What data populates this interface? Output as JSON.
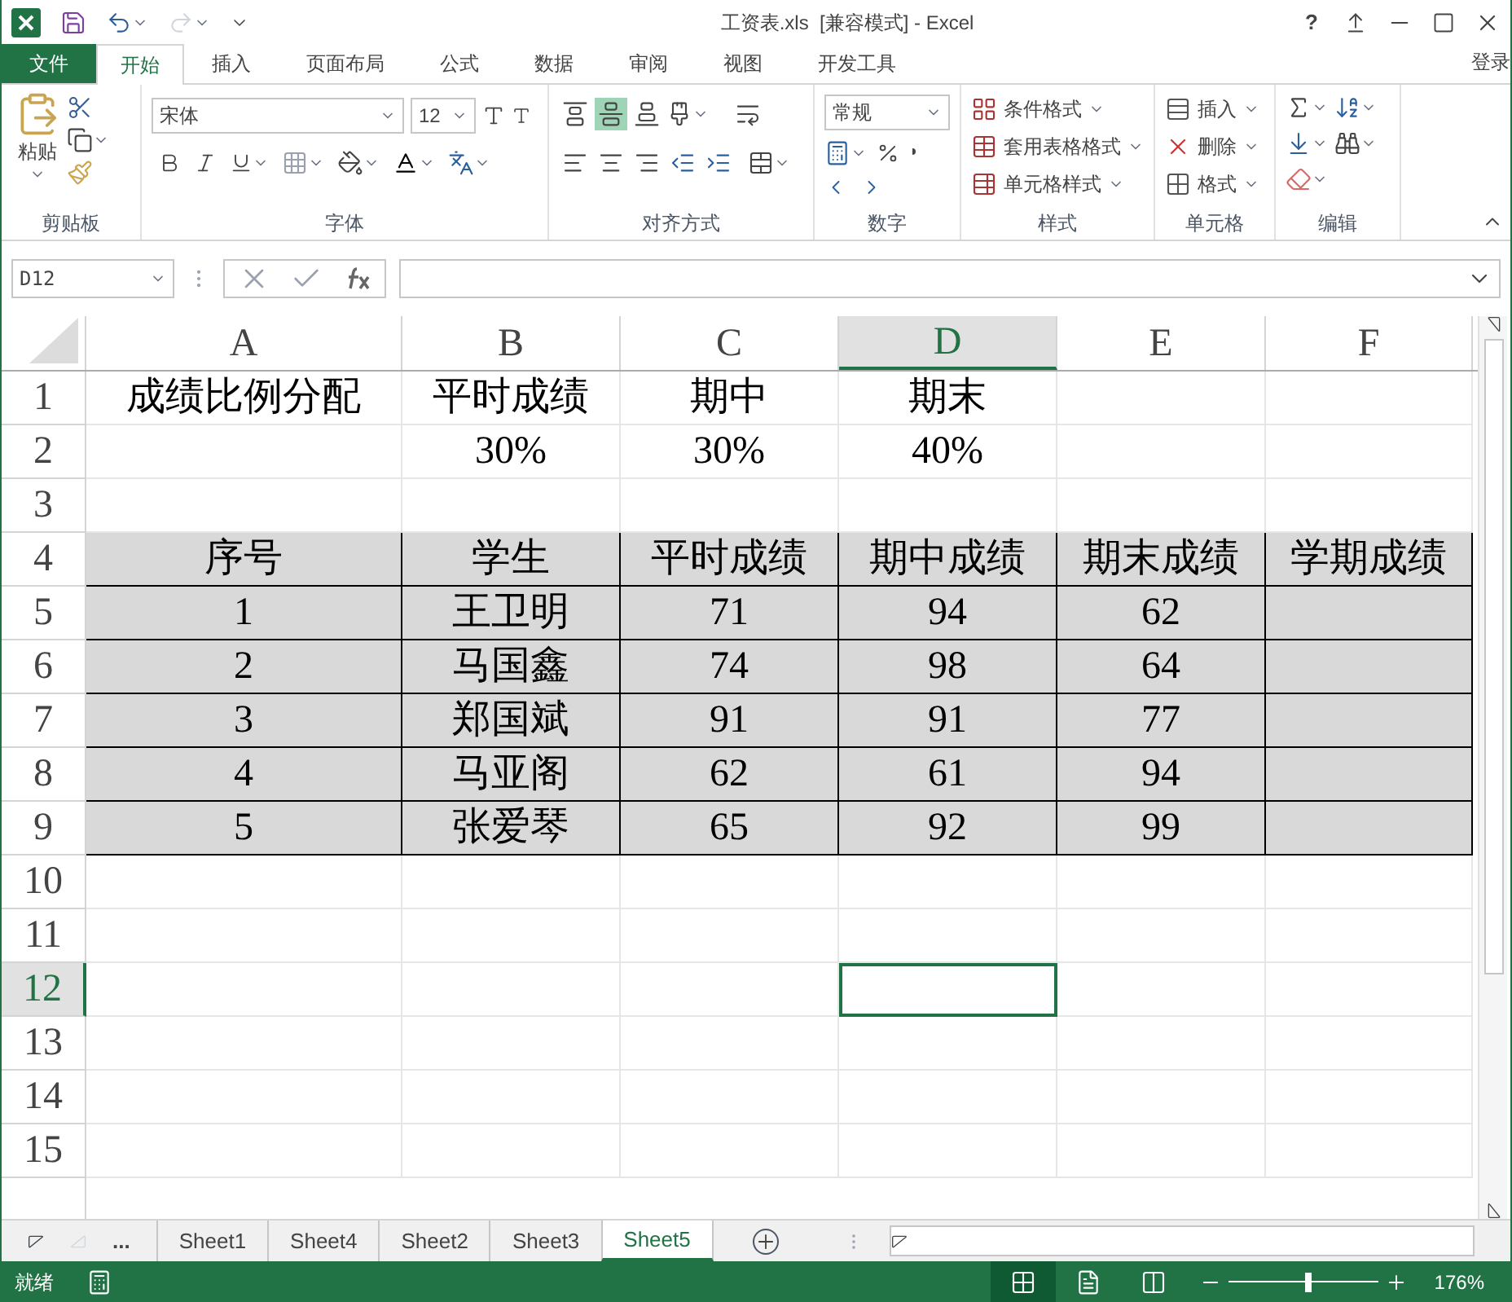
{
  "title_bar": {
    "title": "工资表.xls  [兼容模式] - Excel",
    "help": "?"
  },
  "ribbon_tabs": [
    {
      "label": "文件",
      "kind": "file"
    },
    {
      "label": "开始",
      "kind": "tab",
      "selected": true
    },
    {
      "label": "插入",
      "kind": "tab",
      "selected": false
    },
    {
      "label": "页面布局",
      "kind": "tab",
      "selected": false
    },
    {
      "label": "公式",
      "kind": "tab",
      "selected": false
    },
    {
      "label": "数据",
      "kind": "tab",
      "selected": false
    },
    {
      "label": "审阅",
      "kind": "tab",
      "selected": false
    },
    {
      "label": "视图",
      "kind": "tab",
      "selected": false
    },
    {
      "label": "开发工具",
      "kind": "tab",
      "selected": false
    }
  ],
  "sign_in": "登录",
  "ribbon": {
    "clipboard": {
      "paste": "粘贴",
      "label": "剪贴板"
    },
    "font": {
      "name": "宋体",
      "size": "12",
      "label": "字体"
    },
    "alignment": {
      "label": "对齐方式"
    },
    "number": {
      "format": "常规",
      "label": "数字"
    },
    "styles": {
      "items": [
        "条件格式",
        "套用表格格式",
        "单元格样式"
      ],
      "label": "样式"
    },
    "cells": {
      "items": [
        "插入",
        "删除",
        "格式"
      ],
      "label": "单元格"
    },
    "editing": {
      "label": "编辑"
    }
  },
  "name_box": "D12",
  "columns": [
    {
      "label": "A",
      "selected": false
    },
    {
      "label": "B",
      "selected": false
    },
    {
      "label": "C",
      "selected": false
    },
    {
      "label": "D",
      "selected": true
    },
    {
      "label": "E",
      "selected": false
    },
    {
      "label": "F",
      "selected": false
    }
  ],
  "rows": [
    {
      "number": "1",
      "selected": false,
      "kind": "plain",
      "cells": [
        {
          "text": "成绩比例分配"
        },
        {
          "text": "平时成绩"
        },
        {
          "text": "期中"
        },
        {
          "text": "期末"
        },
        null,
        null
      ]
    },
    {
      "number": "2",
      "selected": false,
      "kind": "plain",
      "cells": [
        null,
        {
          "text": "30%"
        },
        {
          "text": "30%"
        },
        {
          "text": "40%"
        },
        null,
        null
      ]
    },
    {
      "number": "3",
      "selected": false,
      "kind": "plain",
      "cells": [
        null,
        null,
        null,
        null,
        null,
        null
      ]
    },
    {
      "number": "4",
      "selected": false,
      "kind": "table",
      "cells": [
        {
          "text": "序号"
        },
        {
          "text": "学生"
        },
        {
          "text": "平时成绩"
        },
        {
          "text": "期中成绩"
        },
        {
          "text": "期末成绩"
        },
        {
          "text": "学期成绩"
        }
      ]
    },
    {
      "number": "5",
      "selected": false,
      "kind": "table",
      "cells": [
        {
          "text": "1"
        },
        {
          "text": "王卫明"
        },
        {
          "text": "71"
        },
        {
          "text": "94"
        },
        {
          "text": "62"
        },
        null
      ]
    },
    {
      "number": "6",
      "selected": false,
      "kind": "table",
      "cells": [
        {
          "text": "2"
        },
        {
          "text": "马国鑫"
        },
        {
          "text": "74"
        },
        {
          "text": "98"
        },
        {
          "text": "64"
        },
        null
      ]
    },
    {
      "number": "7",
      "selected": false,
      "kind": "table",
      "cells": [
        {
          "text": "3"
        },
        {
          "text": "郑国斌"
        },
        {
          "text": "91"
        },
        {
          "text": "91"
        },
        {
          "text": "77"
        },
        null
      ]
    },
    {
      "number": "8",
      "selected": false,
      "kind": "table",
      "cells": [
        {
          "text": "4"
        },
        {
          "text": "马亚阁"
        },
        {
          "text": "62"
        },
        {
          "text": "61"
        },
        {
          "text": "94"
        },
        null
      ]
    },
    {
      "number": "9",
      "selected": false,
      "kind": "table",
      "cells": [
        {
          "text": "5"
        },
        {
          "text": "张爱琴"
        },
        {
          "text": "65"
        },
        {
          "text": "92"
        },
        {
          "text": "99"
        },
        null
      ]
    },
    {
      "number": "10",
      "selected": false,
      "kind": "plain",
      "cells": [
        null,
        null,
        null,
        null,
        null,
        null
      ]
    },
    {
      "number": "11",
      "selected": false,
      "kind": "plain",
      "cells": [
        null,
        null,
        null,
        null,
        null,
        null
      ]
    },
    {
      "number": "12",
      "selected": true,
      "kind": "plain",
      "cells": [
        null,
        null,
        null,
        {
          "active": true
        },
        null,
        null
      ]
    },
    {
      "number": "13",
      "selected": false,
      "kind": "plain",
      "cells": [
        null,
        null,
        null,
        null,
        null,
        null
      ]
    },
    {
      "number": "14",
      "selected": false,
      "kind": "plain",
      "cells": [
        null,
        null,
        null,
        null,
        null,
        null
      ]
    },
    {
      "number": "15",
      "selected": false,
      "kind": "plain",
      "cells": [
        null,
        null,
        null,
        null,
        null,
        null
      ]
    }
  ],
  "sheet_tabs": {
    "more": "...",
    "tabs": [
      {
        "label": "Sheet1",
        "selected": false
      },
      {
        "label": "Sheet4",
        "selected": false
      },
      {
        "label": "Sheet2",
        "selected": false
      },
      {
        "label": "Sheet3",
        "selected": false
      },
      {
        "label": "Sheet5",
        "selected": true
      }
    ]
  },
  "status_bar": {
    "status": "就绪",
    "zoom": {
      "level": 0.53,
      "reading": "176%"
    }
  }
}
